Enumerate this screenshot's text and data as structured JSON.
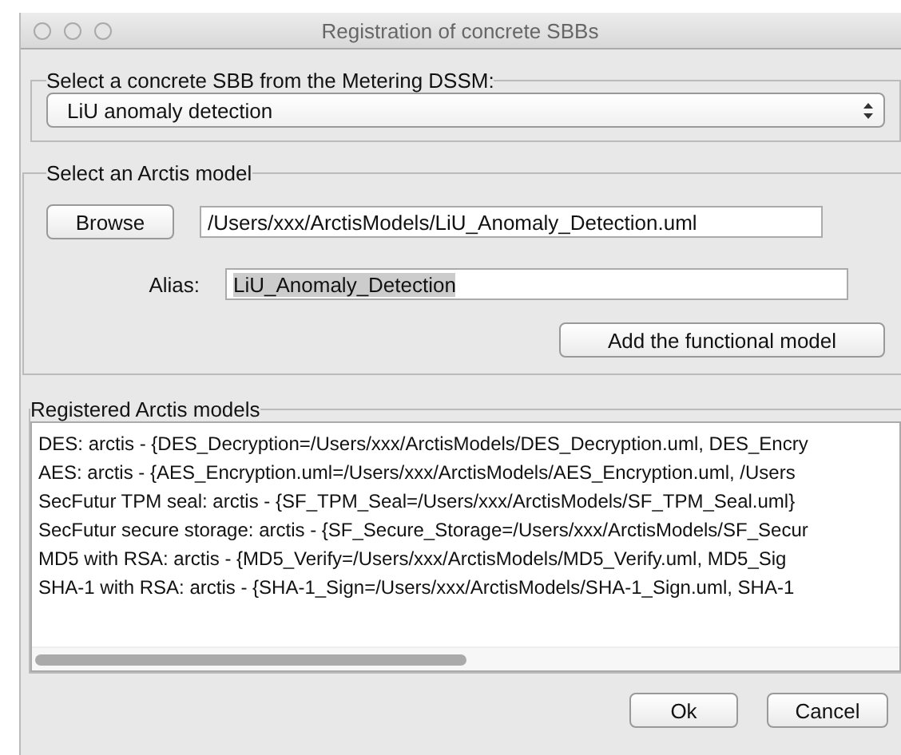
{
  "window": {
    "title": "Registration of concrete SBBs"
  },
  "sbb_group": {
    "title": "Select a concrete SBB from the Metering DSSM:",
    "dropdown": {
      "value": "LiU anomaly detection"
    }
  },
  "model_group": {
    "title": "Select an Arctis model",
    "browse_button": "Browse",
    "path": {
      "value": "/Users/xxx/ArctisModels/LiU_Anomaly_Detection.uml"
    },
    "alias": {
      "label": "Alias:",
      "value": "LiU_Anomaly_Detection",
      "highlighted": true
    },
    "add_button": "Add the functional model"
  },
  "registered_group": {
    "title": "Registered Arctis models",
    "lines": [
      "DES: arctis - {DES_Decryption=/Users/xxx/ArctisModels/DES_Decryption.uml, DES_Encry",
      "AES: arctis - {AES_Encryption.uml=/Users/xxx/ArctisModels/AES_Encryption.uml, /Users",
      "SecFutur TPM seal: arctis - {SF_TPM_Seal=/Users/xxx/ArctisModels/SF_TPM_Seal.uml}",
      "SecFutur secure storage: arctis - {SF_Secure_Storage=/Users/xxx/ArctisModels/SF_Secur",
      "MD5 with RSA: arctis - {MD5_Verify=/Users/xxx/ArctisModels/MD5_Verify.uml, MD5_Sig",
      "SHA-1 with RSA: arctis - {SHA-1_Sign=/Users/xxx/ArctisModels/SHA-1_Sign.uml, SHA-1"
    ]
  },
  "buttons": [
    "Ok",
    "Cancel"
  ]
}
